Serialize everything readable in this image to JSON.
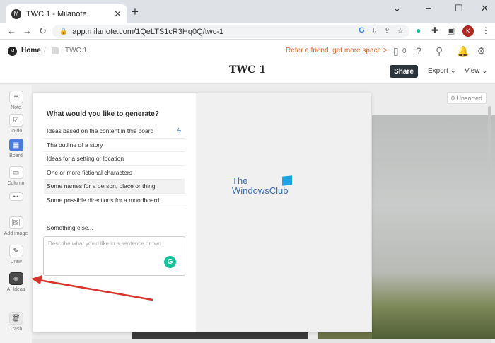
{
  "browser": {
    "tab_title": "TWC 1 - Milanote",
    "tab_close": "✕",
    "new_tab": "+",
    "minimize": "–",
    "maximize": "☐",
    "close": "✕",
    "back": "←",
    "forward": "→",
    "reload": "↻",
    "url": "app.milanote.com/1QeLTS1cR3Hq0Q/twc-1",
    "profile_initial": "K"
  },
  "header": {
    "home_label": "Home",
    "separator": "/",
    "crumb_label": "TWC 1",
    "refer_text": "Refer a friend, get more space >",
    "notifications_count": "0",
    "board_title": "TWC 1",
    "share_label": "Share",
    "export_label": "Export ⌄",
    "view_label": "View ⌄"
  },
  "tools": [
    {
      "name": "note",
      "label": "Note",
      "icon": "≡"
    },
    {
      "name": "todo",
      "label": "To-do",
      "icon": "☑"
    },
    {
      "name": "board",
      "label": "Board",
      "icon": "▦"
    },
    {
      "name": "column",
      "label": "Column",
      "icon": "▭"
    },
    {
      "name": "more",
      "label": "",
      "icon": "•••"
    },
    {
      "name": "add-image",
      "label": "Add image",
      "icon": "🖼"
    },
    {
      "name": "draw",
      "label": "Draw",
      "icon": "✎"
    },
    {
      "name": "ai-ideas",
      "label": "AI Ideas",
      "icon": "◈"
    },
    {
      "name": "trash",
      "label": "Trash",
      "icon": "🗑"
    }
  ],
  "canvas": {
    "unsorted_label": "0 Unsorted"
  },
  "ai_panel": {
    "heading": "What would you like to generate?",
    "options": [
      "Ideas based on the content in this board",
      "The outline of a story",
      "Ideas for a setting or location",
      "One or more fictional characters",
      "Some names for a person, place or thing",
      "Some possible directions for a moodboard"
    ],
    "something_else": "Something else...",
    "prompt_placeholder": "Describe what you'd like in a sentence or two",
    "grammarly_badge": "G",
    "watermark_line1": "The",
    "watermark_line2": "WindowsClub"
  },
  "colors": {
    "refer": "#e8632b",
    "share_bg": "#2b333b",
    "board_tool": "#4a7be0",
    "arrow": "#d9342b"
  }
}
